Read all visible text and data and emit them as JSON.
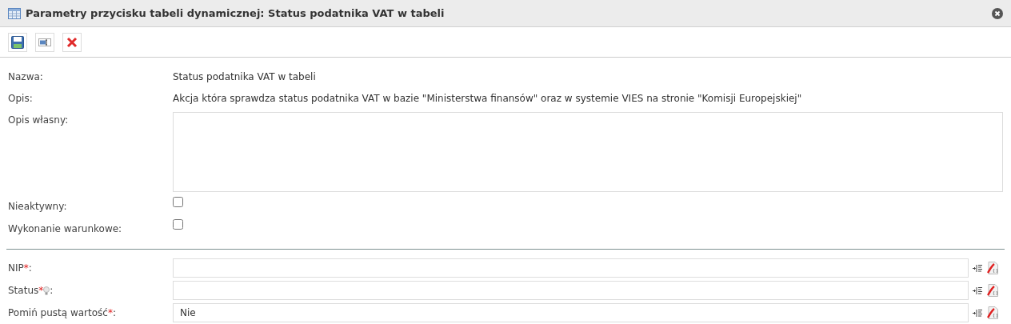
{
  "window": {
    "title": "Parametry przycisku tabeli dynamicznej: Status podatnika VAT w tabeli"
  },
  "toolbar": [
    {
      "kind": "save"
    },
    {
      "kind": "field"
    },
    {
      "kind": "delete"
    }
  ],
  "fields": [
    {
      "kind": "text",
      "label": "Nazwa:",
      "value": "Status podatnika VAT w tabeli"
    },
    {
      "kind": "text",
      "label": "Opis:",
      "value": "Akcja która sprawdza status podatnika VAT w bazie \"Ministerstwa finansów\" oraz w systemie VIES na stronie \"Komisji Europejskiej\""
    },
    {
      "kind": "textarea",
      "label": "Opis własny:"
    },
    {
      "kind": "checkbox",
      "label": "Nieaktywny:",
      "checked": false
    },
    {
      "kind": "checkbox",
      "label": "Wykonanie warunkowe:",
      "checked": false
    }
  ],
  "params": [
    {
      "label": "NIP",
      "required_mark": "*",
      "hint": false,
      "suffix": ":"
    },
    {
      "label": "Status",
      "required_mark": "*",
      "hint": true,
      "suffix": ":"
    },
    {
      "label": "Pomiń pustą wartość",
      "required_mark": "*",
      "hint": false,
      "suffix": ":",
      "value": "Nie"
    }
  ]
}
